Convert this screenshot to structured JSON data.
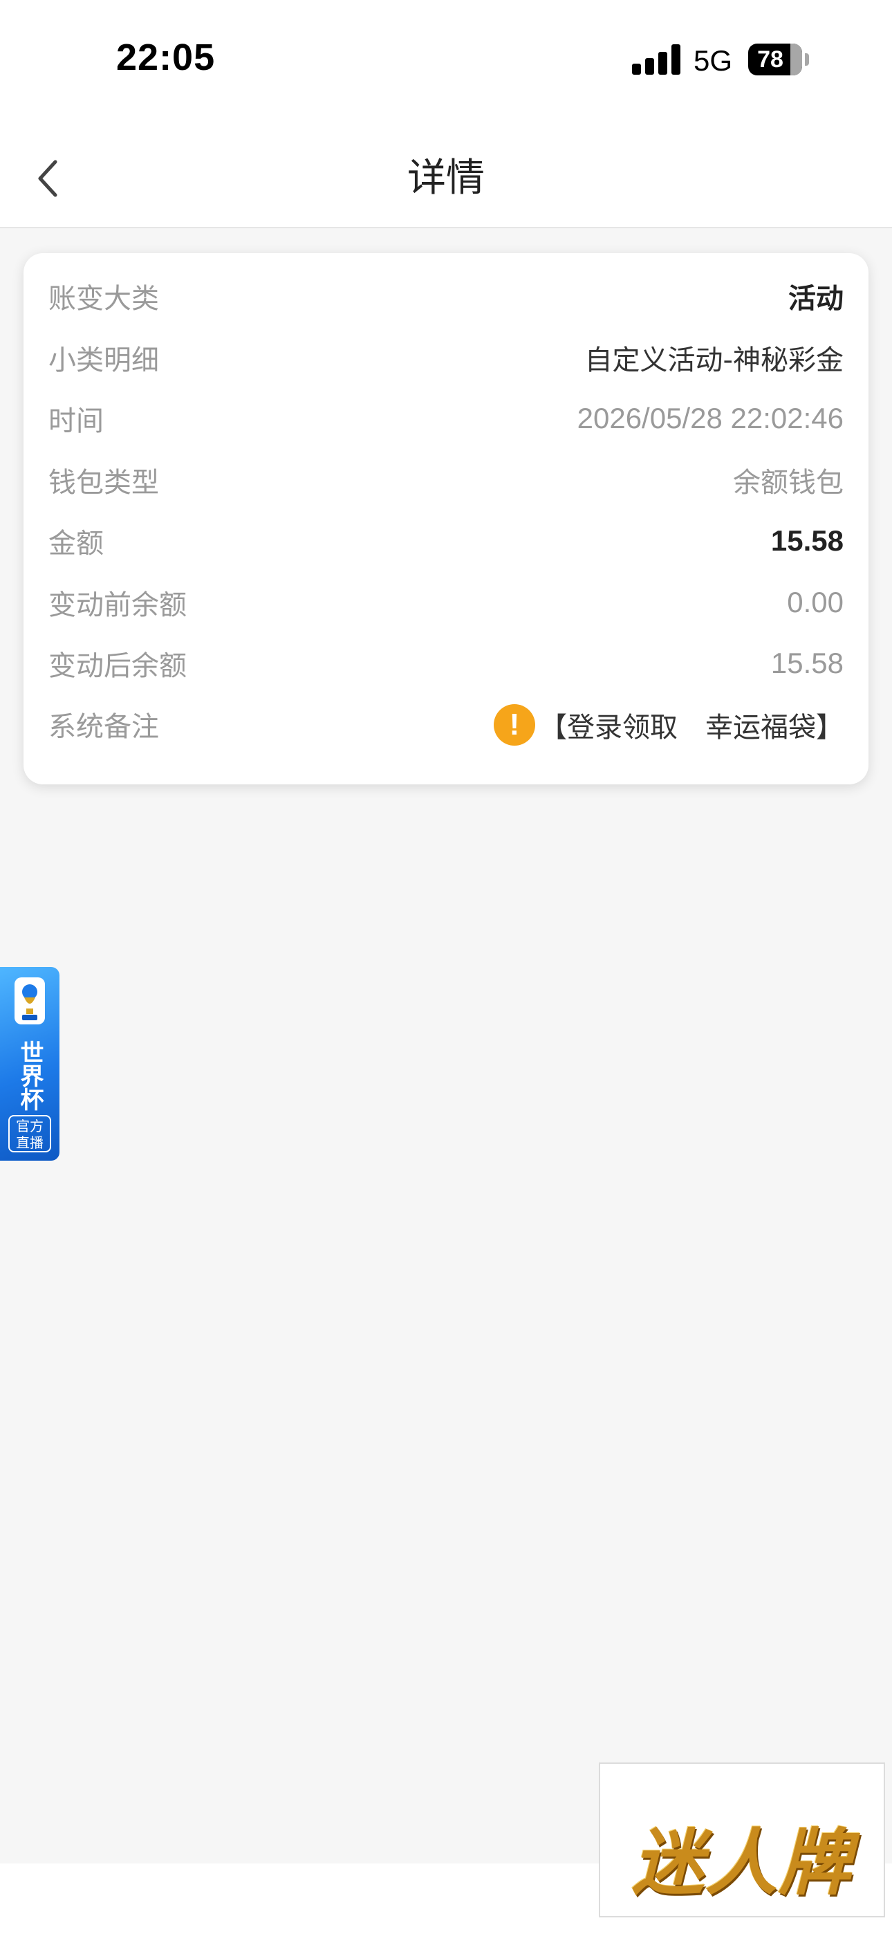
{
  "status_bar": {
    "time": "22:05",
    "network": "5G",
    "battery": "78",
    "battery_level": 0.78,
    "signal_icon": "cellular-signal-icon",
    "battery_icon": "battery-icon"
  },
  "nav": {
    "title": "详情",
    "back_icon": "chevron-left-icon"
  },
  "detail": {
    "rows": [
      {
        "label": "账变大类",
        "value": "活动"
      },
      {
        "label": "小类明细",
        "value": "自定义活动-神秘彩金"
      },
      {
        "label": "时间",
        "value": "2026/05/28 22:02:46"
      },
      {
        "label": "钱包类型",
        "value": "余额钱包"
      },
      {
        "label": "金额",
        "value": "15.58"
      },
      {
        "label": "变动前余额",
        "value": "0.00"
      },
      {
        "label": "变动后余额",
        "value": "15.58"
      },
      {
        "label": "系统备注",
        "value": "【登录领取　幸运福袋】"
      }
    ],
    "note_icon": "warning-icon",
    "note_icon_glyph": "!"
  },
  "world_cup": {
    "title": "世界杯",
    "badge": "官方直播",
    "icon": "trophy-icon"
  },
  "brand": {
    "logo_text": "迷人牌"
  },
  "colors": {
    "background": "#f6f6f6",
    "label_gray": "#9a9a9a",
    "warning_orange": "#f6a51a",
    "world_cup_blue": "#1d7ae8",
    "brand_gold": "#c98b1c"
  }
}
